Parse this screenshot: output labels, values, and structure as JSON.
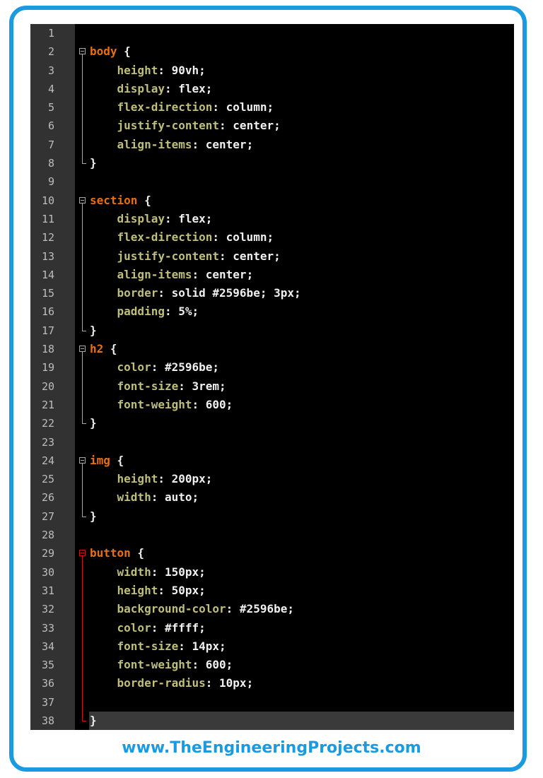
{
  "editor": {
    "lines": [
      {
        "n": "1",
        "segs": []
      },
      {
        "n": "2",
        "segs": [
          [
            "sel",
            "body"
          ],
          [
            "punc",
            " {"
          ]
        ]
      },
      {
        "n": "3",
        "segs": [
          [
            "sp",
            "    "
          ],
          [
            "prop",
            "height"
          ],
          [
            "punc",
            ": "
          ],
          [
            "val",
            "90vh;"
          ]
        ]
      },
      {
        "n": "4",
        "segs": [
          [
            "sp",
            "    "
          ],
          [
            "prop",
            "display"
          ],
          [
            "punc",
            ": "
          ],
          [
            "val",
            "flex;"
          ]
        ]
      },
      {
        "n": "5",
        "segs": [
          [
            "sp",
            "    "
          ],
          [
            "prop",
            "flex-direction"
          ],
          [
            "punc",
            ": "
          ],
          [
            "val",
            "column;"
          ]
        ]
      },
      {
        "n": "6",
        "segs": [
          [
            "sp",
            "    "
          ],
          [
            "prop",
            "justify-content"
          ],
          [
            "punc",
            ": "
          ],
          [
            "val",
            "center;"
          ]
        ]
      },
      {
        "n": "7",
        "segs": [
          [
            "sp",
            "    "
          ],
          [
            "prop",
            "align-items"
          ],
          [
            "punc",
            ": "
          ],
          [
            "val",
            "center;"
          ]
        ]
      },
      {
        "n": "8",
        "segs": [
          [
            "punc",
            "}"
          ]
        ]
      },
      {
        "n": "9",
        "segs": []
      },
      {
        "n": "10",
        "segs": [
          [
            "sel",
            "section"
          ],
          [
            "punc",
            " {"
          ]
        ]
      },
      {
        "n": "11",
        "segs": [
          [
            "sp",
            "    "
          ],
          [
            "prop",
            "display"
          ],
          [
            "punc",
            ": "
          ],
          [
            "val",
            "flex;"
          ]
        ]
      },
      {
        "n": "12",
        "segs": [
          [
            "sp",
            "    "
          ],
          [
            "prop",
            "flex-direction"
          ],
          [
            "punc",
            ": "
          ],
          [
            "val",
            "column;"
          ]
        ]
      },
      {
        "n": "13",
        "segs": [
          [
            "sp",
            "    "
          ],
          [
            "prop",
            "justify-content"
          ],
          [
            "punc",
            ": "
          ],
          [
            "val",
            "center;"
          ]
        ]
      },
      {
        "n": "14",
        "segs": [
          [
            "sp",
            "    "
          ],
          [
            "prop",
            "align-items"
          ],
          [
            "punc",
            ": "
          ],
          [
            "val",
            "center;"
          ]
        ]
      },
      {
        "n": "15",
        "segs": [
          [
            "sp",
            "    "
          ],
          [
            "prop",
            "border"
          ],
          [
            "punc",
            ": "
          ],
          [
            "val",
            "solid #2596be; 3px;"
          ]
        ]
      },
      {
        "n": "16",
        "segs": [
          [
            "sp",
            "    "
          ],
          [
            "prop",
            "padding"
          ],
          [
            "punc",
            ": "
          ],
          [
            "val",
            "5%;"
          ]
        ]
      },
      {
        "n": "17",
        "segs": [
          [
            "punc",
            "}"
          ]
        ]
      },
      {
        "n": "18",
        "segs": [
          [
            "sel",
            "h2"
          ],
          [
            "punc",
            " {"
          ]
        ]
      },
      {
        "n": "19",
        "segs": [
          [
            "sp",
            "    "
          ],
          [
            "prop",
            "color"
          ],
          [
            "punc",
            ": "
          ],
          [
            "val",
            "#2596be;"
          ]
        ]
      },
      {
        "n": "20",
        "segs": [
          [
            "sp",
            "    "
          ],
          [
            "prop",
            "font-size"
          ],
          [
            "punc",
            ": "
          ],
          [
            "val",
            "3rem;"
          ]
        ]
      },
      {
        "n": "21",
        "segs": [
          [
            "sp",
            "    "
          ],
          [
            "prop",
            "font-weight"
          ],
          [
            "punc",
            ": "
          ],
          [
            "val",
            "600;"
          ]
        ]
      },
      {
        "n": "22",
        "segs": [
          [
            "punc",
            "}"
          ]
        ]
      },
      {
        "n": "23",
        "segs": []
      },
      {
        "n": "24",
        "segs": [
          [
            "sel",
            "img"
          ],
          [
            "punc",
            " {"
          ]
        ]
      },
      {
        "n": "25",
        "segs": [
          [
            "sp",
            "    "
          ],
          [
            "prop",
            "height"
          ],
          [
            "punc",
            ": "
          ],
          [
            "val",
            "200px;"
          ]
        ]
      },
      {
        "n": "26",
        "segs": [
          [
            "sp",
            "    "
          ],
          [
            "prop",
            "width"
          ],
          [
            "punc",
            ": "
          ],
          [
            "val",
            "auto;"
          ]
        ]
      },
      {
        "n": "27",
        "segs": [
          [
            "punc",
            "}"
          ]
        ]
      },
      {
        "n": "28",
        "segs": []
      },
      {
        "n": "29",
        "segs": [
          [
            "sel",
            "button"
          ],
          [
            "punc",
            " {"
          ]
        ]
      },
      {
        "n": "30",
        "segs": [
          [
            "sp",
            "    "
          ],
          [
            "prop",
            "width"
          ],
          [
            "punc",
            ": "
          ],
          [
            "val",
            "150px;"
          ]
        ]
      },
      {
        "n": "31",
        "segs": [
          [
            "sp",
            "    "
          ],
          [
            "prop",
            "height"
          ],
          [
            "punc",
            ": "
          ],
          [
            "val",
            "50px;"
          ]
        ]
      },
      {
        "n": "32",
        "segs": [
          [
            "sp",
            "    "
          ],
          [
            "prop",
            "background-color"
          ],
          [
            "punc",
            ": "
          ],
          [
            "val",
            "#2596be;"
          ]
        ]
      },
      {
        "n": "33",
        "segs": [
          [
            "sp",
            "    "
          ],
          [
            "prop",
            "color"
          ],
          [
            "punc",
            ": "
          ],
          [
            "val",
            "#ffff;"
          ]
        ]
      },
      {
        "n": "34",
        "segs": [
          [
            "sp",
            "    "
          ],
          [
            "prop",
            "font-size"
          ],
          [
            "punc",
            ": "
          ],
          [
            "val",
            "14px;"
          ]
        ]
      },
      {
        "n": "35",
        "segs": [
          [
            "sp",
            "    "
          ],
          [
            "prop",
            "font-weight"
          ],
          [
            "punc",
            ": "
          ],
          [
            "val",
            "600;"
          ]
        ]
      },
      {
        "n": "36",
        "segs": [
          [
            "sp",
            "    "
          ],
          [
            "prop",
            "border-radius"
          ],
          [
            "punc",
            ": "
          ],
          [
            "val",
            "10px;"
          ]
        ]
      },
      {
        "n": "37",
        "segs": []
      },
      {
        "n": "38",
        "segs": [
          [
            "punc",
            "}"
          ]
        ]
      }
    ],
    "current_line": "38",
    "colors": {
      "selector": "#e8700f",
      "property": "#bfbe7a",
      "value": "#f0f0f0",
      "fold_active": "#c0171b",
      "frame": "#1a9ae0"
    }
  },
  "caption": "www.TheEngineeringProjects.com"
}
